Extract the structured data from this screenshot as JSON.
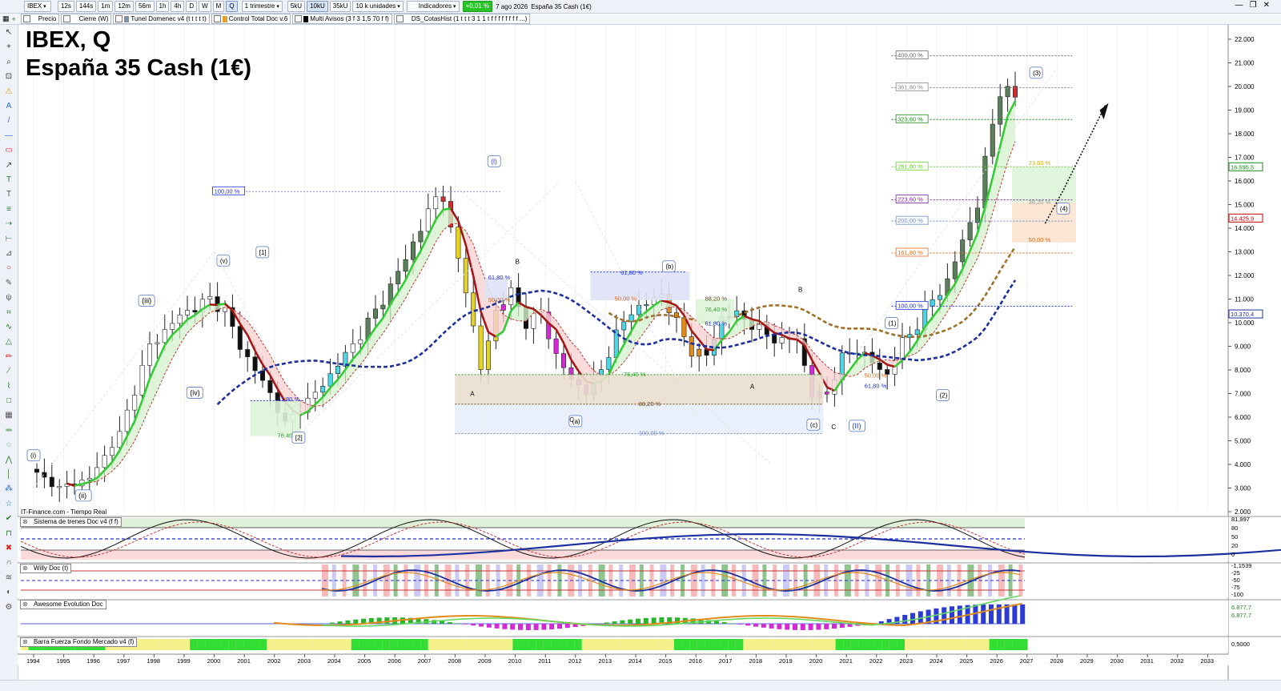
{
  "toolbar": {
    "symbol": "IBEX",
    "timeframes": [
      "12s",
      "144s",
      "1m",
      "12m",
      "56m",
      "1h",
      "4h",
      "D",
      "W",
      "M",
      "Q"
    ],
    "active_timeframe": "Q",
    "period": "1 trimestre",
    "units": [
      "5kU",
      "10kU",
      "35kU"
    ],
    "active_unit": "10kU",
    "units_select": "10 k unidades",
    "indicators_label": "Indicadores",
    "change_pct": "+0,01 %",
    "date": "7 ago 2026",
    "instrument": "España 35 Cash (1€)"
  },
  "indicator_bar": [
    {
      "label": "Precio",
      "color": "#ffffff"
    },
    {
      "label": "Cierre (W)",
      "color": "#ffffff"
    },
    {
      "label": "Tunel Domenec v4 (t t t t t)",
      "color": "#7f8fa6"
    },
    {
      "label": "Control Total Doc v.6",
      "color": "#e5a02a"
    },
    {
      "label": "Multi Avisos (3 f 3 1,5 70 f f)",
      "color": "#000000"
    },
    {
      "label": "DS_CotasHist (1 t t t 3 1 1 t f f f f f f f f ...)",
      "color": "#ffffff"
    }
  ],
  "chart": {
    "title_line1": "IBEX, Q",
    "title_line2": "España 35 Cash (1€)",
    "source": "IT-Finance.com - Tiempo Real",
    "price_axis": [
      "22.000",
      "21.000",
      "20.000",
      "19.000",
      "18.000",
      "17.000",
      "16.000",
      "15.000",
      "14.000",
      "13.000",
      "12.000",
      "11.000",
      "10.000",
      "9.000",
      "8.000",
      "7.000",
      "6.000",
      "5.000",
      "4.000",
      "3.000",
      "2.000"
    ],
    "price_tags": [
      {
        "label": "16.595,5",
        "color": "#1a8a1a",
        "value": 16.6
      },
      {
        "label": "14.425,9",
        "color": "#c00000",
        "value": 14.43
      },
      {
        "label": "10.370,4",
        "color": "#1c2f9e",
        "value": 10.37
      }
    ],
    "years": [
      "1994",
      "1995",
      "1996",
      "1997",
      "1998",
      "1999",
      "2000",
      "2001",
      "2002",
      "2003",
      "2004",
      "2005",
      "2006",
      "2007",
      "2008",
      "2009",
      "2010",
      "2011",
      "2012",
      "2013",
      "2014",
      "2015",
      "2016",
      "2017",
      "2018",
      "2019",
      "2020",
      "2021",
      "2022",
      "2023",
      "2024",
      "2025",
      "2026",
      "2027",
      "2028",
      "2029",
      "2030",
      "2031",
      "2032",
      "2033"
    ],
    "fib_levels": [
      {
        "label": "400,00 %",
        "value": 21.3,
        "color": "#666666"
      },
      {
        "label": "361,80 %",
        "value": 19.95,
        "color": "#888888"
      },
      {
        "label": "323,60 %",
        "value": 18.6,
        "color": "#1a8a1a"
      },
      {
        "label": "261,80 %",
        "value": 16.6,
        "color": "#66cc33"
      },
      {
        "label": "223,60 %",
        "value": 15.2,
        "color": "#7a1fa2"
      },
      {
        "label": "200,00 %",
        "value": 14.3,
        "color": "#6d87c9"
      },
      {
        "label": "161,80 %",
        "value": 12.95,
        "color": "#e06a1a"
      },
      {
        "label": "100,00 %",
        "value": 10.7,
        "color": "#1c2fd6"
      },
      {
        "label": "23,60 %",
        "value": 16.75,
        "color": "#d4b000"
      },
      {
        "label": "38,20 %",
        "value": 15.08,
        "color": "#999999"
      },
      {
        "label": "50,00 %",
        "value": 13.5,
        "color": "#e06a1a"
      },
      {
        "label": "100,00 %",
        "value": 15.55,
        "color": "#1c2fd6"
      },
      {
        "label": "61,80 %",
        "value": 11.9,
        "color": "#1c2fd6"
      },
      {
        "label": "50,00 %",
        "value": 10.95,
        "color": "#e06a1a"
      },
      {
        "label": "76,40 %",
        "value": 5.2,
        "color": "#2aa02a"
      },
      {
        "label": "61,80 %",
        "value": 6.75,
        "color": "#1c2fd6"
      },
      {
        "label": "61,80 %",
        "value": 12.1,
        "color": "#1c2fd6"
      },
      {
        "label": "50,00 %",
        "value": 11.0,
        "color": "#e06a1a"
      },
      {
        "label": "76,40 %",
        "value": 7.8,
        "color": "#2aa02a"
      },
      {
        "label": "88,20 %",
        "value": 6.55,
        "color": "#6b4a16"
      },
      {
        "label": "100,00 %",
        "value": 5.3,
        "color": "#6d87c9"
      },
      {
        "label": "88,20 %",
        "value": 11.0,
        "color": "#6b4a16"
      },
      {
        "label": "76,40 %",
        "value": 10.55,
        "color": "#2aa02a"
      },
      {
        "label": "61,80 %",
        "value": 9.95,
        "color": "#1c2fd6"
      },
      {
        "label": "50,00 %",
        "value": 7.75,
        "color": "#e06a1a"
      },
      {
        "label": "61,80 %",
        "value": 7.3,
        "color": "#1c2fd6"
      }
    ],
    "wave_labels": [
      "(i)",
      "(ii)",
      "(iii)",
      "(iv)",
      "(v)",
      "[1]",
      "[2]",
      "(I)",
      "(a)",
      "(b)",
      "(c)",
      "(II)",
      "(1)",
      "(2)",
      "(3)",
      "(4)"
    ],
    "abc_labels": [
      "A",
      "B",
      "C",
      "A",
      "B",
      "C"
    ]
  },
  "panels": {
    "trenes": {
      "label": "Sistema de trenes Doc v4 (f f)",
      "axis": [
        "81,997",
        "80",
        "50",
        "20",
        "0"
      ]
    },
    "willy": {
      "label": "Willy Doc (t)",
      "axis": [
        "-1,1539",
        "-25",
        "-50",
        "-75",
        "-100"
      ]
    },
    "awesome": {
      "label": "Awesome Evolution Doc",
      "axis": [
        "6.877,7",
        "6.877,7"
      ]
    },
    "barra": {
      "label": "Barra Fuerza Fondo Mercado v4 (f)",
      "axis": [
        "0,5000"
      ]
    }
  },
  "colors": {
    "bull": "#ffffff",
    "bear": "#000000",
    "ma_green": "#33cc33",
    "ma_red": "#a51717",
    "ma_blue": "#1c2f9e",
    "ma_brown": "#a0702a"
  }
}
